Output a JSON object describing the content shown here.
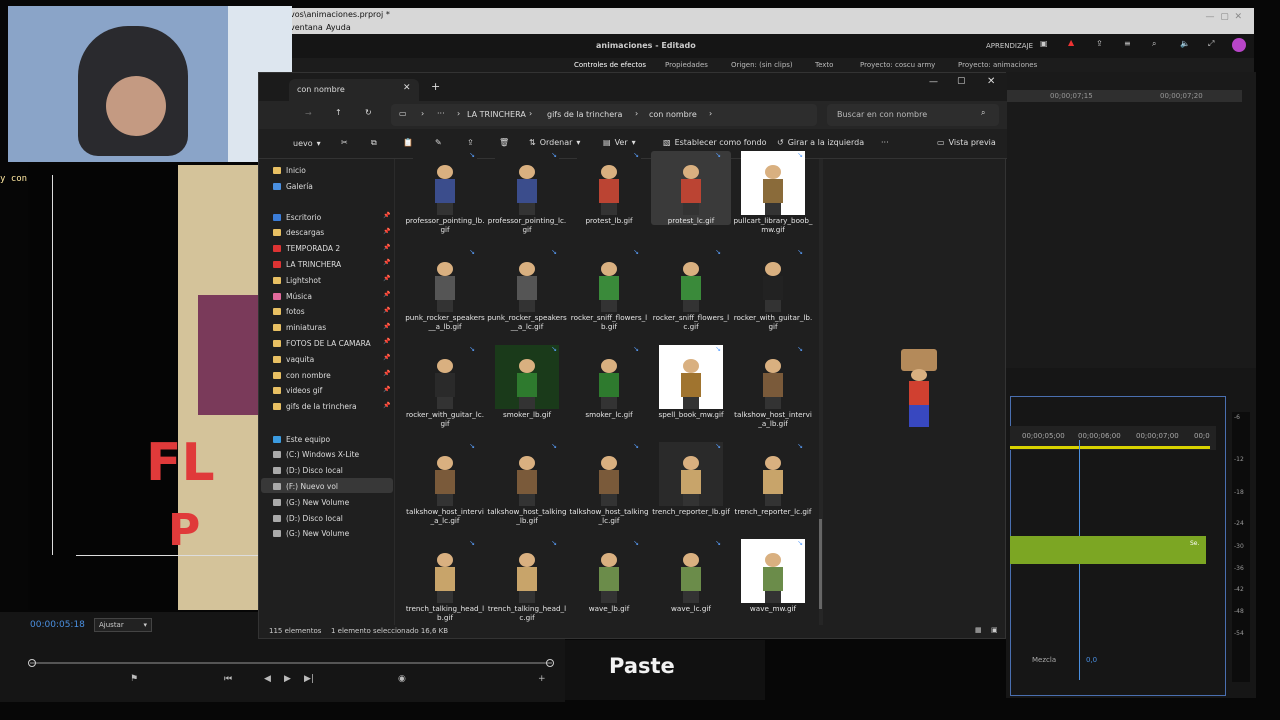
{
  "premiere": {
    "menu_items": [
      "ventana",
      "Ayuda"
    ],
    "path": "vos\\animaciones.prproj *",
    "title": "animaciones - Editado",
    "learn_label": "APRENDIZAJE",
    "panels": [
      "Controles de efectos",
      "Propiedades",
      "Origen: (sin clips)",
      "Texto",
      "Proyecto: coscu army",
      "Proyecto: animaciones"
    ],
    "timecodes_top": [
      "00;00;07;15",
      "00;00;07;20"
    ],
    "timeline_ruler": [
      "00;00;05;00",
      "00;00;06;00",
      "00;00;07;00",
      "00;0"
    ],
    "timecode": "00:00:05:18",
    "fit": "Ajustar",
    "mix_label": "Mezcla",
    "mix_value": "0,0",
    "db_scale": [
      "-6",
      "-12",
      "-18",
      "-24",
      "-30",
      "-36",
      "-42",
      "-48",
      "-54"
    ],
    "clip_label": "Se."
  },
  "stream": {
    "chat_text": "y con la soga al cuello va.",
    "paste_label": "Paste",
    "video_text_1": "FL",
    "video_text_2": "P"
  },
  "explorer": {
    "tab_title": "con nombre",
    "breadcrumb": [
      "LA TRINCHERA",
      "gifs de la trinchera",
      "con nombre"
    ],
    "search_placeholder": "Buscar en con nombre",
    "cmd": {
      "new": "uevo",
      "sort": "Ordenar",
      "view": "Ver",
      "set_bg": "Establecer como fondo",
      "rotate": "Girar a la izquierda",
      "more": "···",
      "preview": "Vista previa"
    },
    "nav_quick": [
      {
        "label": "Inicio",
        "color": "#e8c063",
        "pin": false
      },
      {
        "label": "Galería",
        "color": "#4a8fe0",
        "pin": false
      }
    ],
    "nav_pinned": [
      {
        "label": "Escritorio",
        "color": "#3b7dd8"
      },
      {
        "label": "descargas",
        "color": "#e8c063"
      },
      {
        "label": "TEMPORADA 2",
        "color": "#d33"
      },
      {
        "label": "LA TRINCHERA",
        "color": "#d33"
      },
      {
        "label": "Lightshot",
        "color": "#e8c063"
      },
      {
        "label": "Música",
        "color": "#e26a9c"
      },
      {
        "label": "fotos",
        "color": "#e8c063"
      },
      {
        "label": "miniaturas",
        "color": "#e8c063"
      },
      {
        "label": "FOTOS DE LA CAMARA",
        "color": "#e8c063"
      },
      {
        "label": "vaquita",
        "color": "#e8c063"
      },
      {
        "label": "con nombre",
        "color": "#e8c063"
      },
      {
        "label": "videos gif",
        "color": "#e8c063"
      },
      {
        "label": "gifs de la trinchera",
        "color": "#e8c063"
      }
    ],
    "nav_pc": [
      {
        "label": "Este equipo",
        "color": "#3b9be0"
      },
      {
        "label": "(C:) Windows X-Lite",
        "color": "#aaa"
      },
      {
        "label": "(D:) Disco local",
        "color": "#aaa"
      },
      {
        "label": "(F:) Nuevo vol",
        "color": "#aaa"
      },
      {
        "label": "(G:) New Volume",
        "color": "#aaa"
      },
      {
        "label": "(D:) Disco local",
        "color": "#aaa"
      },
      {
        "label": "(G:) New Volume",
        "color": "#aaa"
      }
    ],
    "files": [
      {
        "name": "professor_pointing_lb.gif",
        "bg": "#1f1f1f",
        "fig": "#3b4d8c"
      },
      {
        "name": "professor_pointing_lc.gif",
        "bg": "#1f1f1f",
        "fig": "#3b4d8c"
      },
      {
        "name": "protest_lb.gif",
        "bg": "#1f1f1f",
        "fig": "#b43"
      },
      {
        "name": "protest_lc.gif",
        "bg": "#3a3a3a",
        "fig": "#b43"
      },
      {
        "name": "pullcart_library_boob_mw.gif",
        "bg": "#ffffff",
        "fig": "#8a6b3a"
      },
      {
        "name": "punk_rocker_speakers__a_lb.gif",
        "bg": "#1f1f1f",
        "fig": "#555"
      },
      {
        "name": "punk_rocker_speakers__a_lc.gif",
        "bg": "#1f1f1f",
        "fig": "#555"
      },
      {
        "name": "rocker_sniff_flowers_lb.gif",
        "bg": "#1f1f1f",
        "fig": "#3a8a3a"
      },
      {
        "name": "rocker_sniff_flowers_lc.gif",
        "bg": "#1f1f1f",
        "fig": "#3a8a3a"
      },
      {
        "name": "rocker_with_guitar_lb.gif",
        "bg": "#1f1f1f",
        "fig": "#222"
      },
      {
        "name": "rocker_with_guitar_lc.gif",
        "bg": "#1f1f1f",
        "fig": "#2a2a2a"
      },
      {
        "name": "smoker_lb.gif",
        "bg": "#1a3a1a",
        "fig": "#2e7a2e"
      },
      {
        "name": "smoker_lc.gif",
        "bg": "#1f1f1f",
        "fig": "#2e7a2e"
      },
      {
        "name": "spell_book_mw.gif",
        "bg": "#ffffff",
        "fig": "#a0742f"
      },
      {
        "name": "talkshow_host_intervi_a_lb.gif",
        "bg": "#1f1f1f",
        "fig": "#7a5a3a"
      },
      {
        "name": "talkshow_host_intervi_a_lc.gif",
        "bg": "#1f1f1f",
        "fig": "#7a5a3a"
      },
      {
        "name": "talkshow_host_talking_lb.gif",
        "bg": "#1f1f1f",
        "fig": "#7a5a3a"
      },
      {
        "name": "talkshow_host_talking_lc.gif",
        "bg": "#1f1f1f",
        "fig": "#7a5a3a"
      },
      {
        "name": "trench_reporter_lb.gif",
        "bg": "#2a2a2a",
        "fig": "#c8a46a"
      },
      {
        "name": "trench_reporter_lc.gif",
        "bg": "#1f1f1f",
        "fig": "#c8a46a"
      },
      {
        "name": "trench_talking_head_lb.gif",
        "bg": "#1f1f1f",
        "fig": "#c8a46a"
      },
      {
        "name": "trench_talking_head_lc.gif",
        "bg": "#1f1f1f",
        "fig": "#c8a46a"
      },
      {
        "name": "wave_lb.gif",
        "bg": "#1f1f1f",
        "fig": "#6b8c4a"
      },
      {
        "name": "wave_lc.gif",
        "bg": "#1f1f1f",
        "fig": "#6b8c4a"
      },
      {
        "name": "wave_mw.gif",
        "bg": "#ffffff",
        "fig": "#6b8c4a"
      }
    ],
    "status": {
      "count": "115 elementos",
      "selected": "1 elemento seleccionado 16,6 KB"
    }
  }
}
